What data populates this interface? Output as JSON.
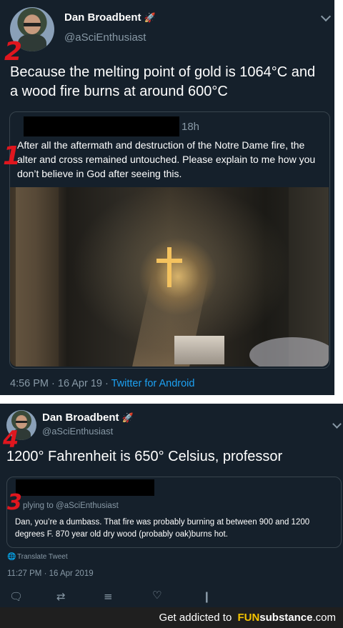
{
  "tweet1": {
    "name": "Dan Broadbent",
    "name_emoji": "🚀",
    "handle": "@aSciEnthusiast",
    "text": "Because the melting point of gold is 1064°C and a wood fire burns at around 600°C",
    "annotation": "2",
    "quoted": {
      "time": "18h",
      "annotation": "1",
      "text": "After all the aftermath and destruction of the Notre Dame fire, the alter and cross remained untouched. Please explain to me how you don’t believe in God after seeing this."
    },
    "meta": "4:56 PM · 16 Apr 19 · ",
    "source": "Twitter for Android"
  },
  "tweet2": {
    "name": "Dan Broadbent",
    "name_emoji": "🚀",
    "handle": "@aSciEnthusiast",
    "annotation": "4",
    "text": "1200° Fahrenheit is 650° Celsius, professor",
    "quoted": {
      "annotation": "3",
      "replying": "plying to @aSciEnthusiast",
      "text": "Dan, you’re a dumbass. That fire was probably burning at between 900 and 1200 degrees F.  870 year old dry wood (probably oak)burns hot."
    },
    "translate": "Translate Tweet",
    "meta": "11:27 PM · 16 Apr 2019"
  },
  "icons": [
    "chevron-down-icon",
    "globe-icon",
    "reply-icon",
    "retweet-icon",
    "share-stack-icon",
    "like-icon",
    "analytics-icon"
  ],
  "footer": {
    "text": "Get addicted to",
    "brand_a": "FUN",
    "brand_b": "substance",
    "brand_c": ".com"
  }
}
